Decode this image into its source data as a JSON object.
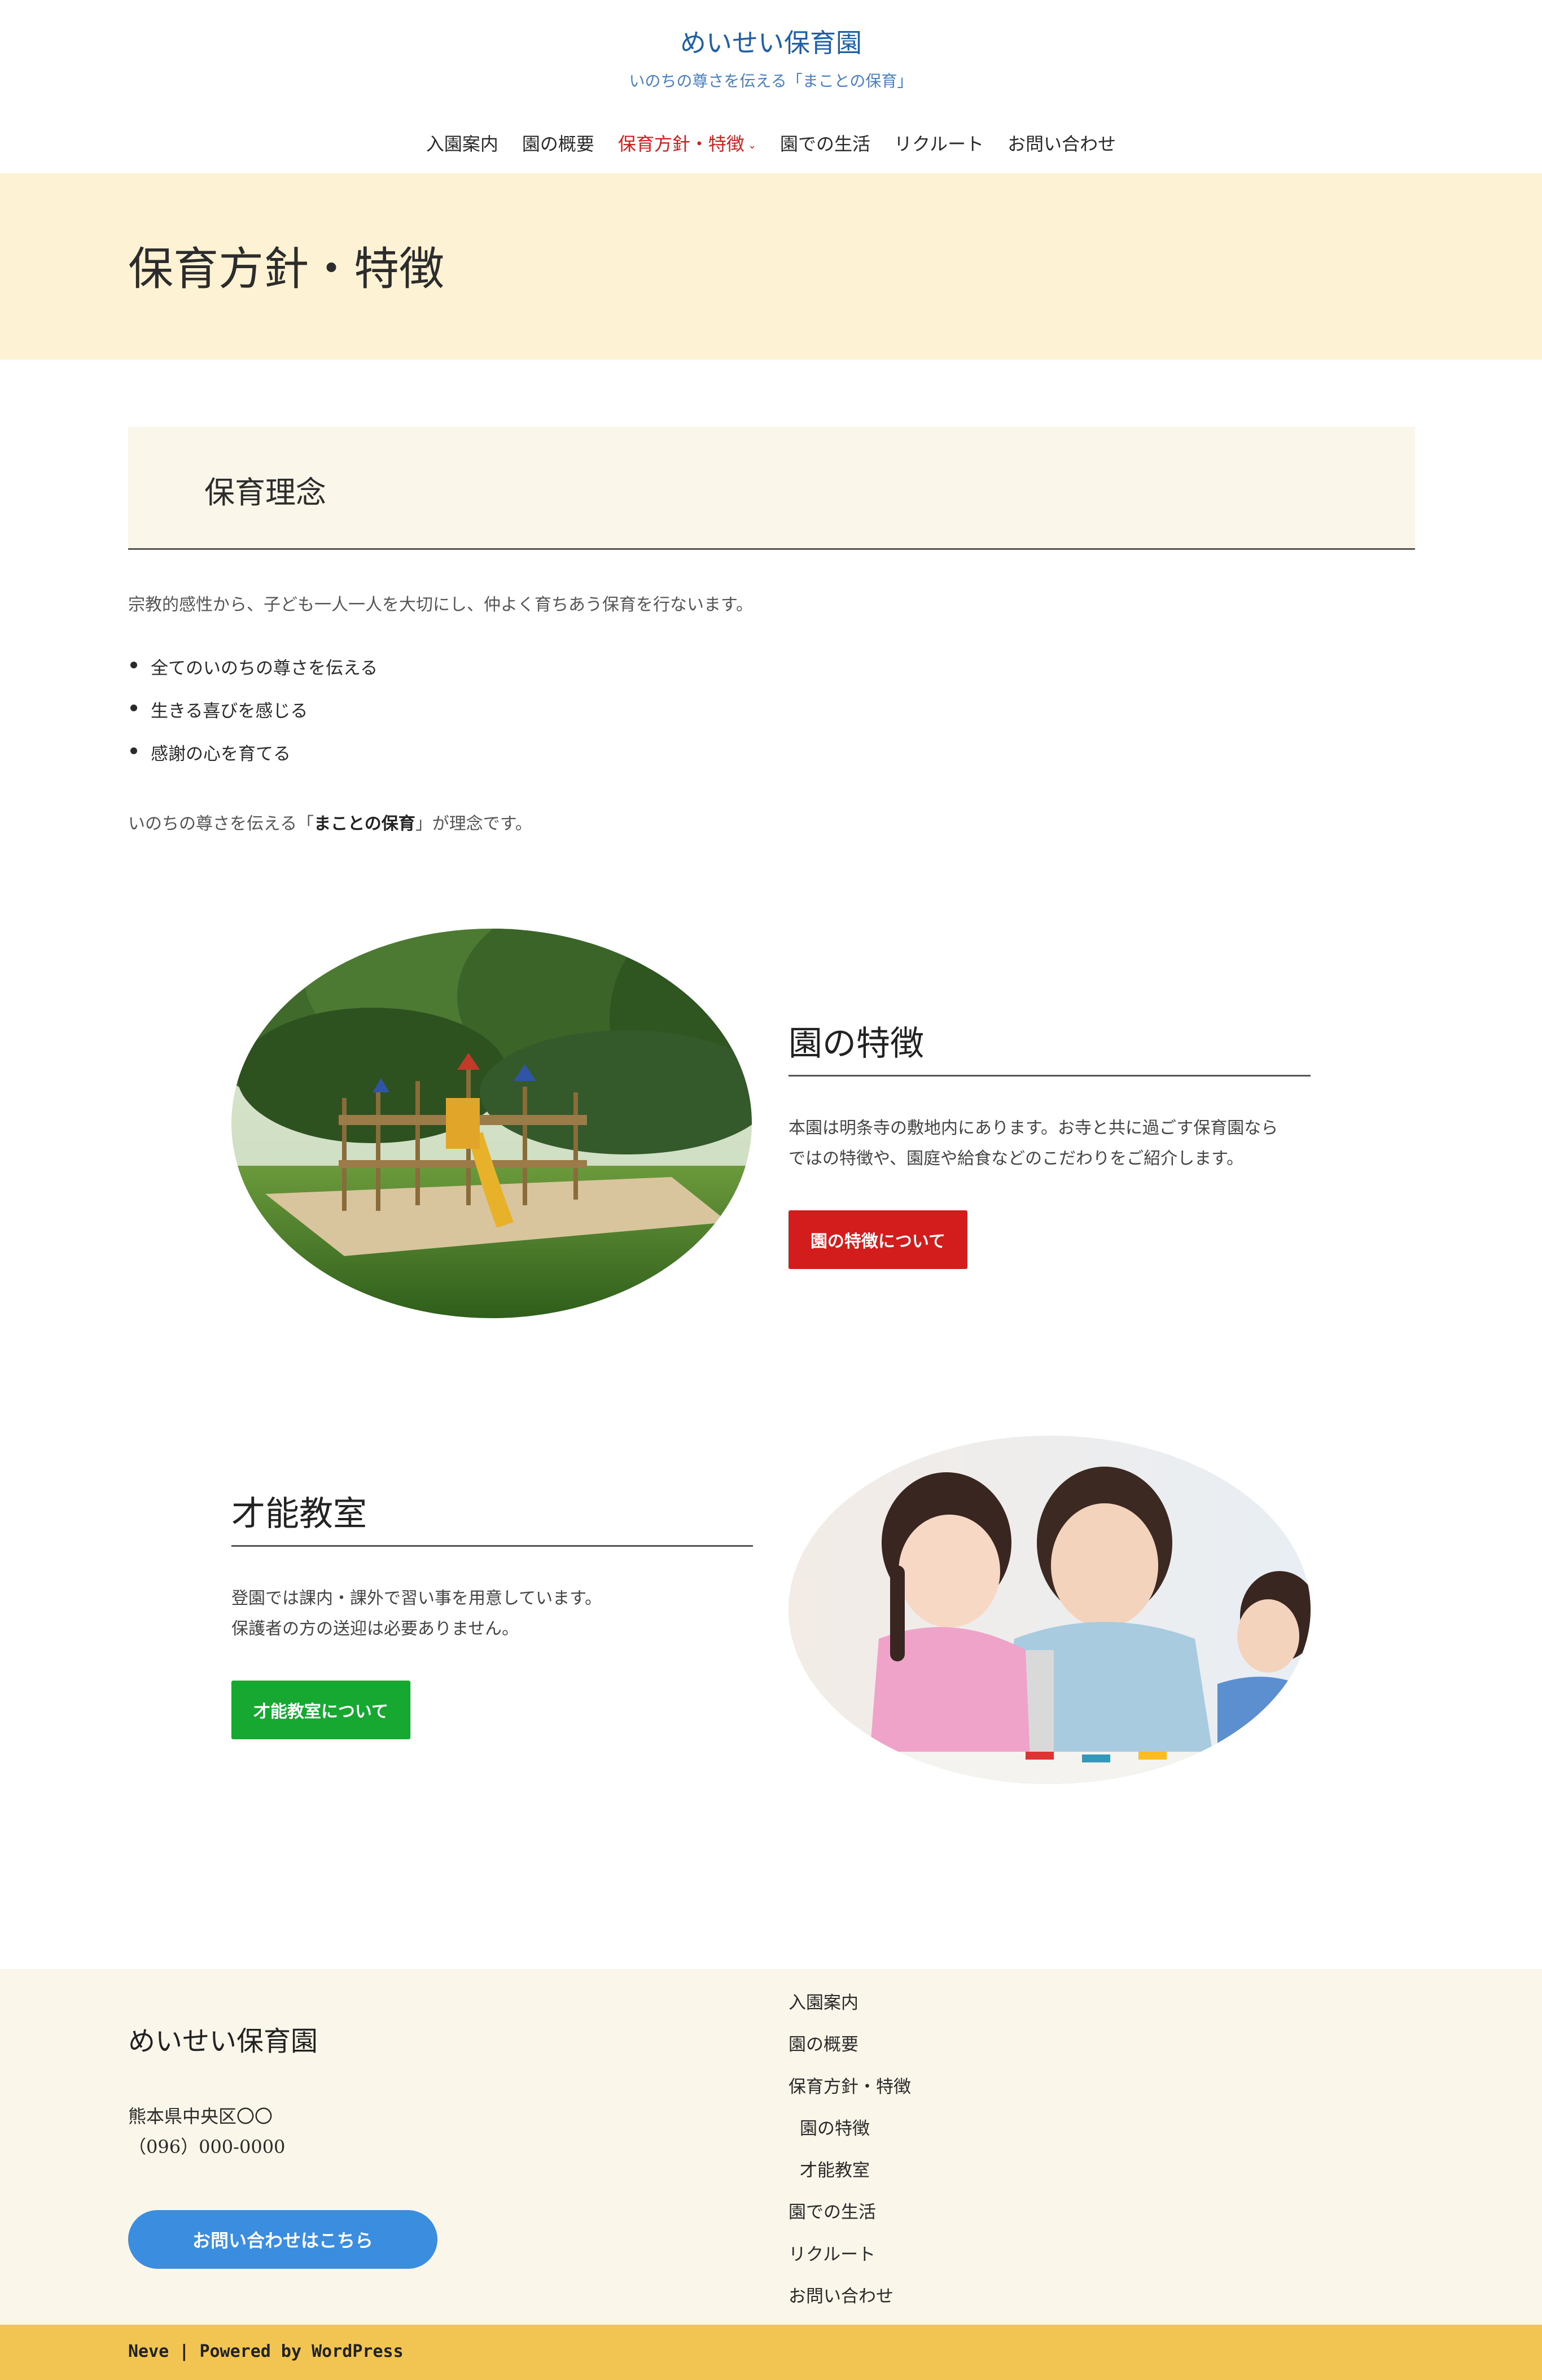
{
  "header": {
    "site_title": "めいせい保育園",
    "tagline": "いのちの尊さを伝える「まことの保育」",
    "nav": [
      {
        "label": "入園案内"
      },
      {
        "label": "園の概要"
      },
      {
        "label": "保育方針・特徴",
        "active": true
      },
      {
        "label": "園での生活"
      },
      {
        "label": "リクルート"
      },
      {
        "label": "お問い合わせ"
      }
    ],
    "nav_caret": "⌄"
  },
  "hero": {
    "title": "保育方針・特徴"
  },
  "philosophy": {
    "heading": "保育理念",
    "intro": "宗教的感性から、子ども一人一人を大切にし、仲よく育ちあう保育を行ないます。",
    "values": [
      "全てのいのちの尊さを伝える",
      "生きる喜びを感じる",
      "感謝の心を育てる"
    ],
    "closing_prefix": "いのちの尊さを伝える「",
    "closing_bold": "まことの保育",
    "closing_suffix": "」が理念です。"
  },
  "features": {
    "garden": {
      "heading": "園の特徴",
      "desc_line1": "本園は明条寺の敷地内にあります。お寺と共に過ごす保育園なら",
      "desc_line2": "ではの特徴や、園庭や給食などのこだわりをご紹介します。",
      "button": "園の特徴について"
    },
    "classes": {
      "heading": "才能教室",
      "desc_line1": "登園では課内・課外で習い事を用意しています。",
      "desc_line2": "保護者の方の送迎は必要ありません。",
      "button": "才能教室について"
    }
  },
  "footer": {
    "name": "めいせい保育園",
    "address": "熊本県中央区〇〇",
    "phone": "（096）000-0000",
    "contact_button": "お問い合わせはこちら",
    "menu": [
      {
        "label": "入園案内"
      },
      {
        "label": "園の概要"
      },
      {
        "label": "保育方針・特徴"
      },
      {
        "label": "園の特徴",
        "sub": true
      },
      {
        "label": "才能教室",
        "sub": true
      },
      {
        "label": "園での生活"
      },
      {
        "label": "リクルート"
      },
      {
        "label": "お問い合わせ"
      }
    ],
    "credit_theme": "Neve",
    "credit_sep": " | ",
    "credit_powered": "Powered by WordPress"
  },
  "colors": {
    "title_blue": "#1f5fa8",
    "nav_active": "#d31d1d",
    "hero_bg": "#fef2d4",
    "cream": "#fbf6ea",
    "btn_red": "#d31d1d",
    "btn_green": "#16a830",
    "btn_blue": "#3b8de0",
    "footer_bar": "#f2c452"
  }
}
